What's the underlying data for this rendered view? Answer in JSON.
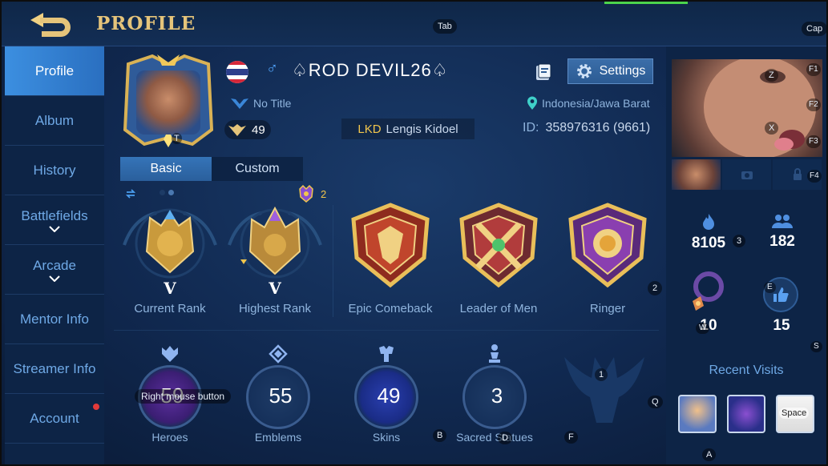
{
  "header": {
    "title": "PROFILE"
  },
  "hints": {
    "tab": "Tab",
    "cap": "Cap",
    "f1": "F1",
    "f2": "F2",
    "f3": "F3",
    "f4": "F4",
    "t": "T",
    "z": "Z",
    "x": "X",
    "n3": "3",
    "n2": "2",
    "n1": "1",
    "e": "E",
    "w": "W",
    "s": "S",
    "q": "Q",
    "b": "B",
    "d": "D",
    "f": "F",
    "a": "A",
    "rmb": "Right mouse button",
    "space": "Space"
  },
  "sidebar": {
    "items": [
      {
        "label": "Profile"
      },
      {
        "label": "Album"
      },
      {
        "label": "History"
      },
      {
        "label": "Battlefields"
      },
      {
        "label": "Arcade"
      },
      {
        "label": "Mentor Info"
      },
      {
        "label": "Streamer Info"
      },
      {
        "label": "Account"
      }
    ]
  },
  "profile": {
    "gender_symbol": "♂",
    "username": "♤ROD DEVIL26♤",
    "title": "No Title",
    "level": "49",
    "squad_tag": "LKD",
    "squad_name": "Lengis Kidoel",
    "settings_label": "Settings",
    "location": "Indonesia/Jawa Barat",
    "id_label": "ID:",
    "id_value": "358976316 (9661)"
  },
  "tabs": [
    {
      "label": "Basic"
    },
    {
      "label": "Custom"
    }
  ],
  "medal_count": "2",
  "ranks": [
    {
      "label": "Current Rank",
      "tier": "V"
    },
    {
      "label": "Highest Rank",
      "tier": "V"
    },
    {
      "label": "Epic Comeback"
    },
    {
      "label": "Leader of Men"
    },
    {
      "label": "Ringer"
    }
  ],
  "stats": [
    {
      "label": "Heroes",
      "value": "59"
    },
    {
      "label": "Emblems",
      "value": "55"
    },
    {
      "label": "Skins",
      "value": "49"
    },
    {
      "label": "Sacred Statues",
      "value": "3"
    }
  ],
  "right": {
    "popularity": "8105",
    "followers": "182",
    "charm": "10",
    "likes": "15",
    "recent_visits_title": "Recent Visits"
  },
  "colors": {
    "accent": "#e5c47a",
    "active_tab": "#3574b8",
    "sidebar_text": "#6fa9e6",
    "alert": "#e23a3a"
  }
}
